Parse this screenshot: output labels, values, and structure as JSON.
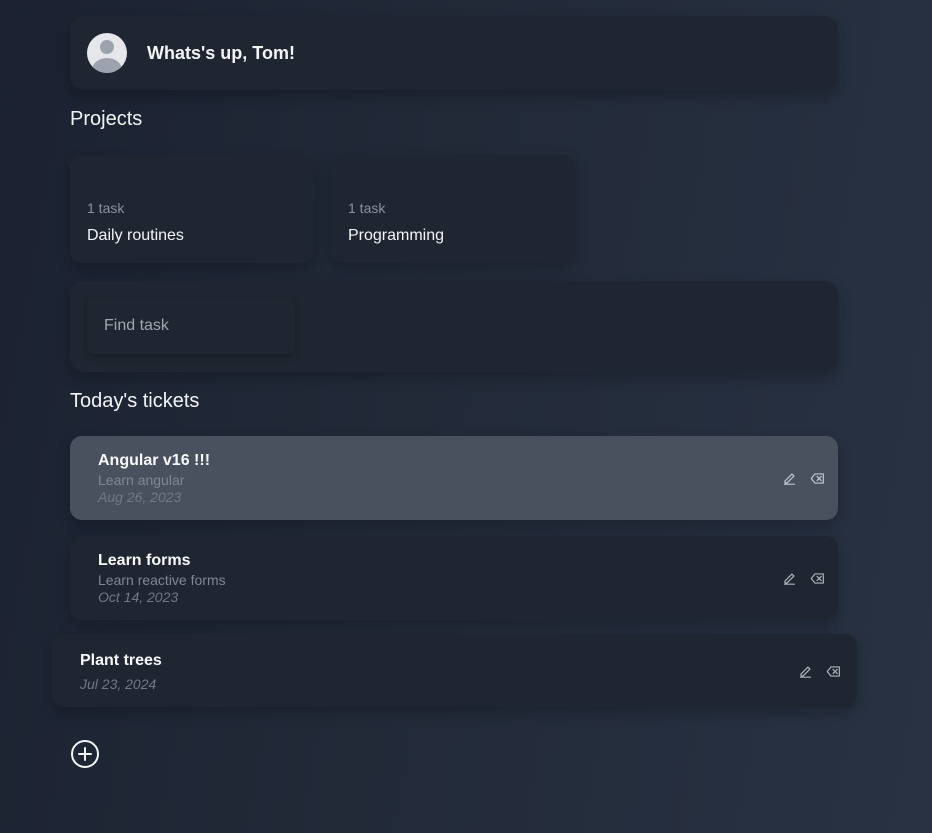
{
  "header": {
    "greeting": "Whats's up, Tom!"
  },
  "projects": {
    "title": "Projects",
    "items": [
      {
        "count": "1 task",
        "name": "Daily routines"
      },
      {
        "count": "1 task",
        "name": "Programming"
      }
    ]
  },
  "search": {
    "placeholder": "Find task",
    "value": ""
  },
  "tickets": {
    "title": "Today's tickets",
    "items": [
      {
        "title": "Angular v16 !!!",
        "description": "Learn angular",
        "date": "Aug 26, 2023"
      },
      {
        "title": "Learn forms",
        "description": "Learn reactive forms",
        "date": "Oct 14, 2023"
      },
      {
        "title": "Plant trees",
        "description": "",
        "date": "Jul 23, 2024"
      }
    ]
  },
  "icons": {
    "avatar": "user-avatar-icon",
    "edit": "pencil-icon",
    "delete": "backspace-icon",
    "add": "plus-circle-icon"
  },
  "colors": {
    "background": "#1f2533",
    "card": "#202631",
    "card_highlighted": "#4a515e",
    "text_primary": "#f3f4f6",
    "text_muted": "#7f8793"
  }
}
